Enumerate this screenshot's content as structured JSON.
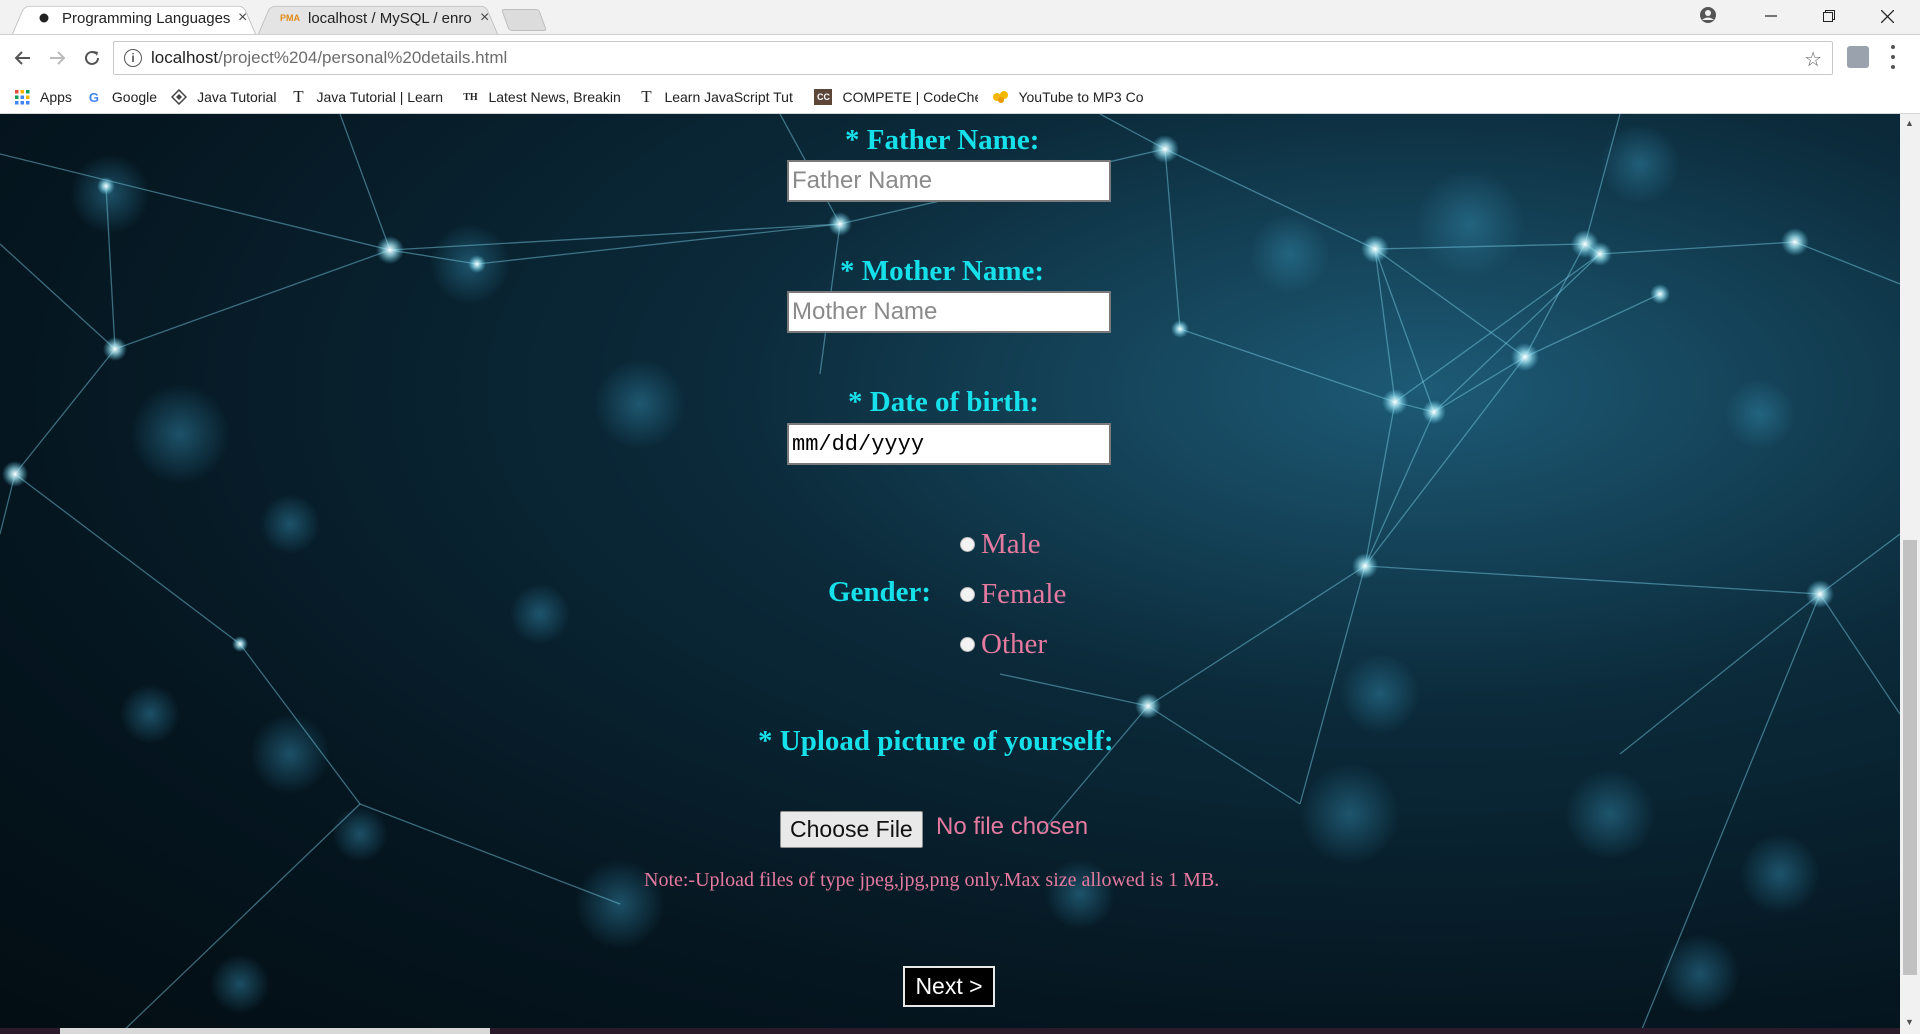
{
  "browser": {
    "tabs": [
      {
        "title": "Programming Languages",
        "active": true,
        "close": "×"
      },
      {
        "title": "localhost / MySQL / enro",
        "active": false,
        "close": "×",
        "favicon_text": "PMA"
      }
    ],
    "address_url_host": "localhost",
    "address_url_path": "/project%204/personal%20details.html",
    "bookmarks": [
      {
        "label": "Apps",
        "icon": "apps-grid-icon"
      },
      {
        "label": "Google",
        "icon": "google-icon",
        "icon_text": "G"
      },
      {
        "label": "Java Tutorial",
        "icon": "java-tutorial-icon"
      },
      {
        "label": "Java Tutorial | Learn",
        "icon": "tutorialspoint-icon",
        "icon_text": "T"
      },
      {
        "label": "Latest News, Breakin",
        "icon": "news-icon",
        "icon_text": "TH"
      },
      {
        "label": "Learn JavaScript Tut",
        "icon": "tutorialspoint-icon",
        "icon_text": "T"
      },
      {
        "label": "COMPETE | CodeChe",
        "icon": "codechef-icon",
        "icon_text": "CC"
      },
      {
        "label": "YouTube to MP3 Co",
        "icon": "mp3-icon"
      }
    ]
  },
  "form": {
    "father_label": "* Father Name:",
    "father_placeholder": "Father Name",
    "mother_label": "* Mother Name:",
    "mother_placeholder": "Mother Name",
    "dob_label": "* Date of birth:",
    "dob_placeholder": "mm/dd/yyyy",
    "gender_label": "Gender:",
    "gender_options": [
      "Male",
      "Female",
      "Other"
    ],
    "upload_label": "* Upload picture of yourself:",
    "choose_file_label": "Choose File",
    "no_file_text": "No file chosen",
    "note": "Note:-Upload files of type jpeg,jpg,png only.Max size allowed is 1 MB.",
    "next_label": "Next >"
  },
  "colors": {
    "label_color": "#16e0ea",
    "pink_text": "#e57aa0"
  }
}
